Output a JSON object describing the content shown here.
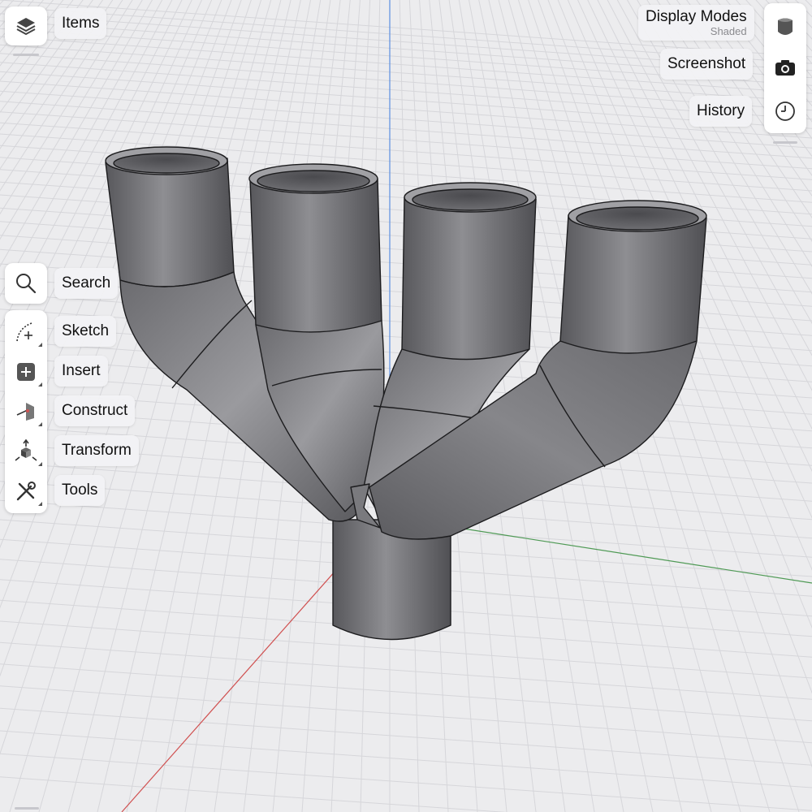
{
  "left_panel": {
    "items_label": "Items",
    "search_label": "Search",
    "tools": [
      {
        "label": "Sketch",
        "icon": "sketch-icon"
      },
      {
        "label": "Insert",
        "icon": "insert-icon"
      },
      {
        "label": "Construct",
        "icon": "construct-icon"
      },
      {
        "label": "Transform",
        "icon": "transform-icon"
      },
      {
        "label": "Tools",
        "icon": "tools-icon"
      }
    ]
  },
  "right_panel": {
    "display_modes_label": "Display Modes",
    "display_modes_value": "Shaded",
    "screenshot_label": "Screenshot",
    "history_label": "History"
  },
  "viewport": {
    "object": "four-into-one exhaust manifold",
    "colors": {
      "x_axis": "#d24a4a",
      "y_axis": "#4a9a4a",
      "z_axis": "#4a7fd8",
      "grid": "#d4d4d8",
      "body": "#6f6f73"
    }
  }
}
